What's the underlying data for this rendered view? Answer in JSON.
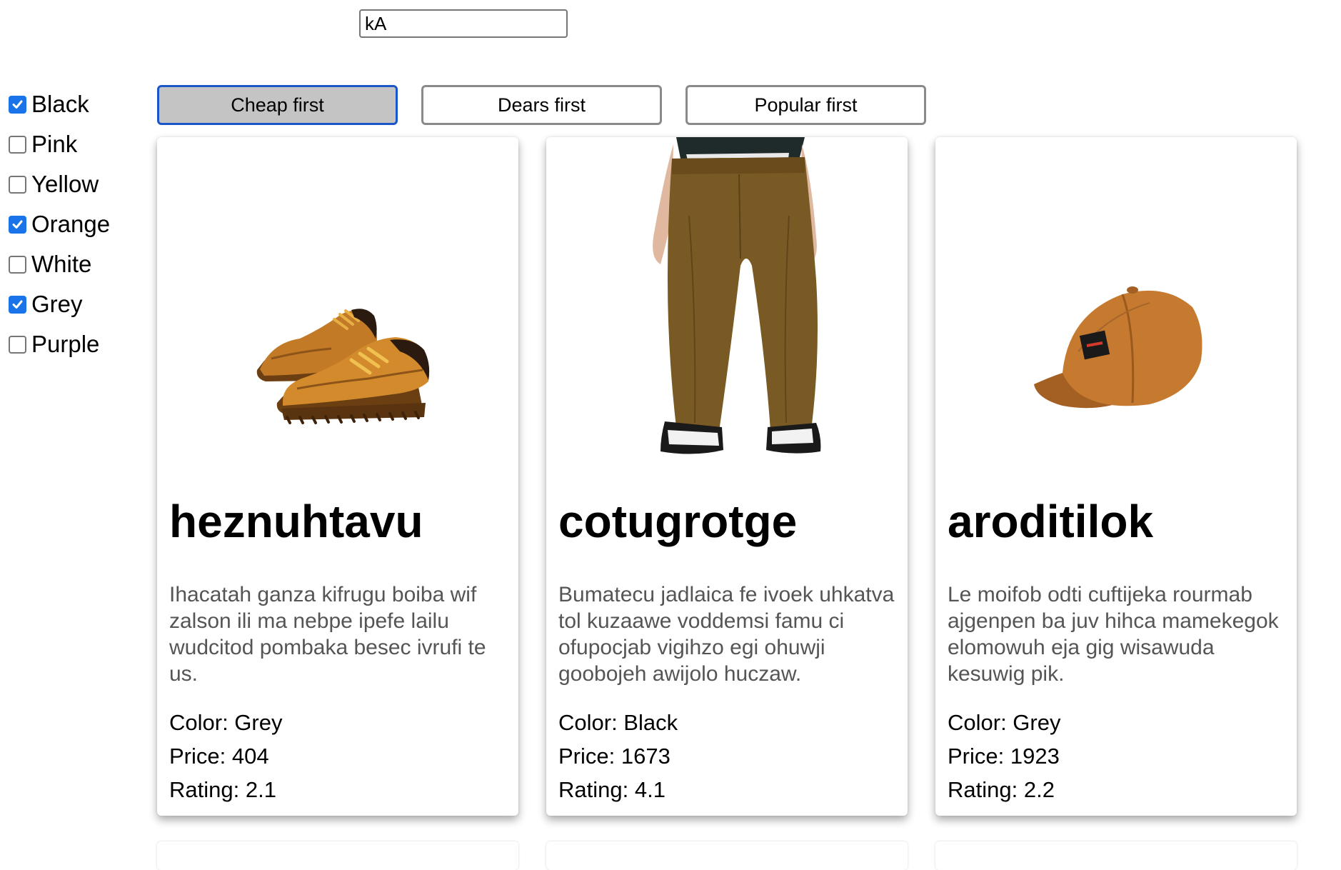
{
  "search": {
    "value": "kA"
  },
  "filters": [
    {
      "label": "Black",
      "checked": true
    },
    {
      "label": "Pink",
      "checked": false
    },
    {
      "label": "Yellow",
      "checked": false
    },
    {
      "label": "Orange",
      "checked": true
    },
    {
      "label": "White",
      "checked": false
    },
    {
      "label": "Grey",
      "checked": true
    },
    {
      "label": "Purple",
      "checked": false
    }
  ],
  "sort": {
    "cheap_label": "Cheap first",
    "dear_label": "Dears first",
    "popular_label": "Popular first",
    "active": "cheap"
  },
  "products": [
    {
      "title": "heznuhtavu",
      "description": "Ihacatah ganza kifrugu boiba wif zalson ili ma nebpe ipefe lailu wudcitod pombaka besec ivrufi te us.",
      "color": "Color: Grey",
      "price": "Price: 404",
      "rating": "Rating: 2.1",
      "image": "boat-shoes-icon"
    },
    {
      "title": "cotugrotge",
      "description": "Bumatecu jadlaica fe ivoek uhkatva tol kuzaawe voddemsi famu ci ofupocjab vigihzo egi ohuwji goobojeh awijolo huczaw.",
      "color": "Color: Black",
      "price": "Price: 1673",
      "rating": "Rating: 4.1",
      "image": "chino-pants-icon"
    },
    {
      "title": "aroditilok",
      "description": "Le moifob odti cuftijeka rourmab ajgenpen ba juv hihca mamekegok elomowuh eja gig wisawuda kesuwig pik.",
      "color": "Color: Grey",
      "price": "Price: 1923",
      "rating": "Rating: 2.2",
      "image": "baseball-cap-icon"
    }
  ]
}
